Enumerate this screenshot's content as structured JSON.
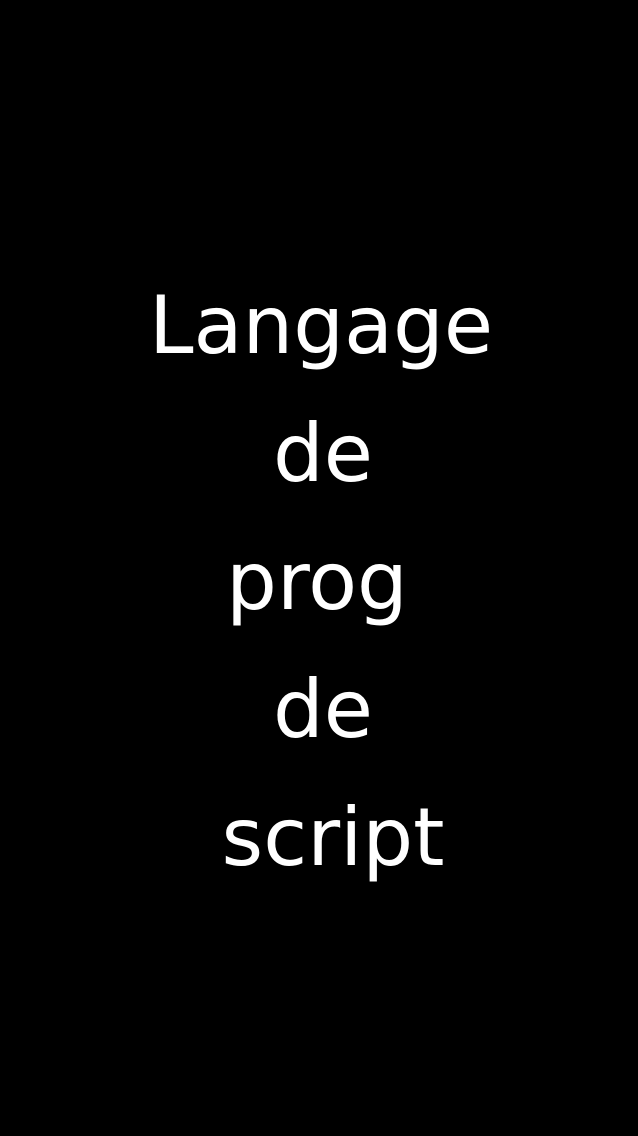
{
  "screen": {
    "background": "#000000",
    "text_color": "#ffffff",
    "lines": [
      "Langage",
      "de",
      "prog",
      "de",
      "script"
    ]
  }
}
